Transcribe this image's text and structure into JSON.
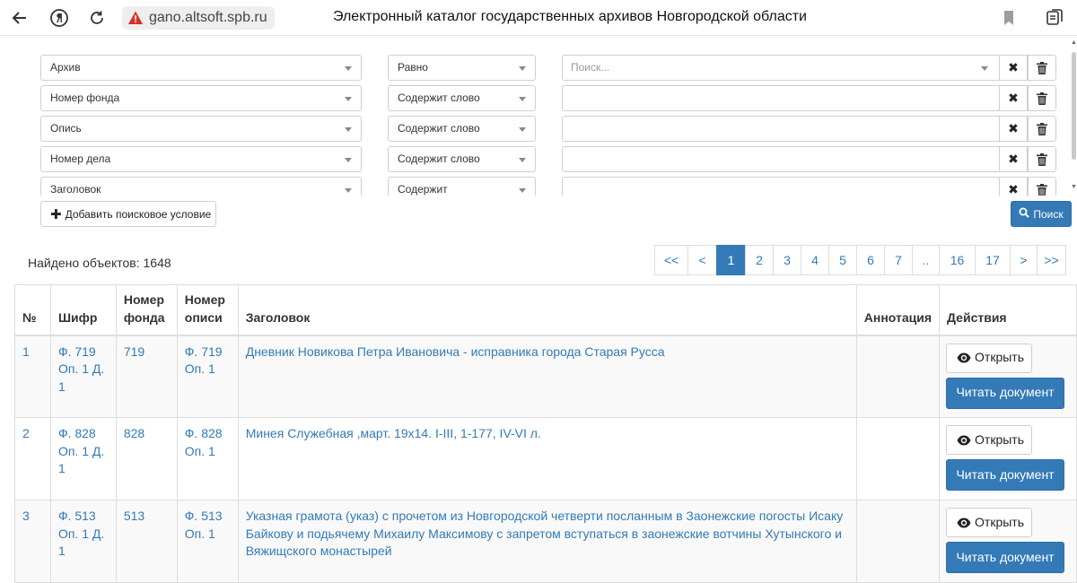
{
  "browser": {
    "url": "gano.altsoft.spb.ru",
    "title": "Электронный каталог государственных архивов Новгородской области"
  },
  "conditions": [
    {
      "field": "Архив",
      "operator": "Равно",
      "value": "",
      "placeholder": "Поиск..."
    },
    {
      "field": "Номер фонда",
      "operator": "Содержит слово",
      "value": "",
      "placeholder": ""
    },
    {
      "field": "Опись",
      "operator": "Содержит слово",
      "value": "",
      "placeholder": ""
    },
    {
      "field": "Номер дела",
      "operator": "Содержит слово",
      "value": "",
      "placeholder": ""
    },
    {
      "field": "Заголовок",
      "operator": "Содержит",
      "value": "",
      "placeholder": ""
    }
  ],
  "icons": {
    "clear": "times-icon",
    "delete": "trash-icon"
  },
  "add_condition_label": "Добавить поисковое условие",
  "search_label": "Поиск",
  "found_label": "Найдено объектов: 1648",
  "pagination": [
    "<<",
    "<",
    "1",
    "2",
    "3",
    "4",
    "5",
    "6",
    "7",
    "..",
    "16",
    "17",
    ">",
    ">>"
  ],
  "pagination_active": "1",
  "table": {
    "headers": {
      "num": "№",
      "code": "Шифр",
      "fond": "Номер фонда",
      "opis": "Номер описи",
      "title": "Заголовок",
      "annotation": "Аннотация",
      "actions": "Действия"
    },
    "open_label": "Открыть",
    "read_label": "Читать документ",
    "rows": [
      {
        "num": "1",
        "code": "Ф. 719 Оп. 1 Д. 1",
        "fond": "719",
        "opis": "Ф. 719 Оп. 1",
        "title": "Дневник Новикова Петра Ивановича - исправника города Старая Русса",
        "annotation": ""
      },
      {
        "num": "2",
        "code": "Ф. 828 Оп. 1 Д. 1",
        "fond": "828",
        "opis": "Ф. 828 Оп. 1",
        "title": "Минея Служебная ,март. 19х14. I-III, 1-177, IV-VI л.",
        "annotation": ""
      },
      {
        "num": "3",
        "code": "Ф. 513 Оп. 1 Д. 1",
        "fond": "513",
        "opis": "Ф. 513 Оп. 1",
        "title": "Указная грамота (указ) с прочетом из Новгородской четверти посланным в Заонежские погосты Исаку Байкову и подьячему Михаилу Максимову с запретом вступаться в заонежские вотчины Хутынского и Вяжищского монастырей",
        "annotation": ""
      }
    ]
  }
}
